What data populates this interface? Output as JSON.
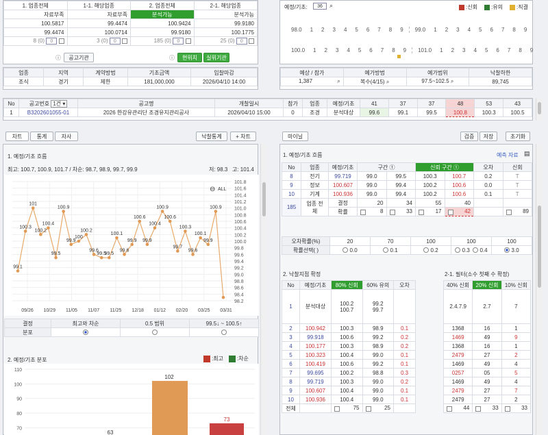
{
  "top_left": {
    "headers": [
      "1. 업종전체",
      "1-1. 해당업종",
      "2. 업종전체",
      "2-1. 해당업종"
    ],
    "rows": [
      [
        "자료부족",
        "자료부족",
        "분석가능",
        "분석가능"
      ],
      [
        "100.5817",
        "99.4474",
        "100.9424",
        "99.9180"
      ],
      [
        "99.4474",
        "100.0714",
        "99.9180",
        "100.1775"
      ]
    ],
    "counts": [
      "8 (0)",
      "3 (0)",
      "185 (0)",
      "25 (0)"
    ],
    "inputs": [
      "0",
      "0",
      "0",
      "0"
    ],
    "btn_notice": "공고기관",
    "btn_rank": "현위치",
    "btn_live": "실위기관"
  },
  "info_table": {
    "headers": [
      "업종",
      "지역",
      "계약방법",
      "기초금액",
      "입찰마감"
    ],
    "values": [
      "조식",
      "경기",
      "제한",
      "181,000,000",
      "2026/04/10 14:00"
    ]
  },
  "forecast": {
    "label": "예정/기초:",
    "value": "36",
    "legend": [
      {
        "label": ":신회",
        "color": "#c0392b"
      },
      {
        "label": ":유의",
        "color": "#2e7d32"
      },
      {
        "label": ":직결",
        "color": "#e0b030"
      }
    ],
    "row1_left": [
      "98.0",
      "1",
      "2",
      "3",
      "4",
      "5",
      "6",
      "7",
      "8",
      "9"
    ],
    "row1_right": [
      "99.0",
      "1",
      "2",
      "3",
      "4",
      "5",
      "6",
      "7",
      "8",
      "9"
    ],
    "row2_left": [
      "100.0",
      "1",
      "2",
      "3",
      "4",
      "5",
      "6",
      "7",
      "8",
      "9"
    ],
    "row2_right": [
      "101.0",
      "1",
      "2",
      "3",
      "4",
      "5",
      "6",
      "7",
      "8",
      "9"
    ]
  },
  "estimate": {
    "headers": [
      "예상 / 참가",
      "예가방법",
      "예가범위",
      "낙찰하한"
    ],
    "values": [
      "1,387",
      "복수(4/15)",
      "97.5~102.5",
      "89,745"
    ]
  },
  "bid_row": {
    "headers": [
      "No",
      "공고번호",
      "공고명",
      "개찰일시",
      "참가",
      "업종",
      "예정/기초",
      "41",
      "37",
      "37",
      "48",
      "53",
      "43"
    ],
    "count_select": "1건",
    "values": [
      "1",
      "B3202601055-01",
      "2026 한강유관리단 조경유지관리공사",
      "2026/04/10 15:00",
      "0",
      "조경",
      "분석대상",
      "99.6",
      "99.1",
      "99.5",
      "100.8",
      "100.3",
      "100.5"
    ]
  },
  "tabs_left": [
    "차트",
    "통계",
    "자사"
  ],
  "btn_stats": "낙찰통계",
  "btn_add_chart": "+ 차트",
  "tab_my": "마이닐",
  "btn_verify": "검증",
  "btn_save": "저장",
  "btn_reset": "초기화",
  "chart_section": {
    "title": "1. 예정/기초 흐름",
    "summary": "최고: 100.7, 100.9, 101.7 / 차순: 98.7, 98.9, 99.7, 99.9",
    "low": "저: 98.3",
    "high": "고: 101.4",
    "all_label": "ALL"
  },
  "chart_data": [
    {
      "type": "line",
      "title": "1. 예정/기초 흐름",
      "x": [
        "09/26",
        "10/29",
        "11/05",
        "11/07",
        "11/25",
        "12/18",
        "01/12",
        "02/20",
        "03/25",
        "03/31"
      ],
      "ylim": [
        98.2,
        101.8
      ],
      "yticks": [
        "101.8",
        "101.6",
        "101.4",
        "101.2",
        "101.0",
        "100.8",
        "100.6",
        "100.4",
        "100.2",
        "100.0",
        "99.8",
        "99.6",
        "99.4",
        "99.2",
        "99.0",
        "98.8",
        "98.6",
        "98.4",
        "98.2"
      ],
      "values": [
        99.1,
        100.3,
        101,
        100.2,
        100.4,
        99.5,
        100.9,
        99.9,
        100,
        100.2,
        99.6,
        99.5,
        99.5,
        100.1,
        99.6,
        99.9,
        100.6,
        99.9,
        100.4,
        100.9,
        100.6,
        99.7,
        100.3,
        99.6,
        100.1,
        99.9,
        100.9,
        98.3
      ],
      "labels": [
        "99.1",
        "100.3",
        "101",
        "100.2",
        "100.4",
        "99.5",
        "100.9",
        "99.9",
        "100",
        "100.2",
        "99.6",
        "99.5",
        "99.5",
        "100.1",
        "99.6",
        "99.9",
        "100.6",
        "99.9",
        "100.4",
        "100.9",
        "100.6",
        "99.7",
        "100.3",
        "99.6",
        "100.1",
        "99.9",
        "100.9",
        ""
      ]
    },
    {
      "type": "bar",
      "title": "2. 예정/기초 분포",
      "legend": [
        {
          "label": ":최고",
          "color": "#c0392b"
        },
        {
          "label": ":차순",
          "color": "#2e7d32"
        }
      ],
      "yticks": [
        "110",
        "100",
        "90",
        "80",
        "70"
      ],
      "ylim": [
        65,
        110
      ],
      "series": [
        {
          "name": "최고",
          "values": [
            63,
            102,
            73
          ]
        }
      ]
    }
  ],
  "chart_footer": {
    "headers": [
      "결정",
      "최고와 차순",
      "0.5 범위",
      "99.5↓ ~ 100.5↑"
    ],
    "row_label": "분포"
  },
  "flow_table": {
    "title": "1. 예정/기초 흐름",
    "link": "예측 자료",
    "headers": [
      "No",
      "업종",
      "예정/기초",
      "구간 ①",
      "신뢰 구간 ①",
      "오차",
      "신회"
    ],
    "rows": [
      [
        "8",
        "전기",
        "99.719",
        "99.0",
        "99.5",
        "100.3",
        "100.7",
        "0.2",
        "T"
      ],
      [
        "9",
        "정보",
        "100.607",
        "99.0",
        "99.4",
        "100.2",
        "100.6",
        "0.0",
        "T"
      ],
      [
        "10",
        "기계",
        "100.936",
        "99.0",
        "99.4",
        "100.2",
        "100.6",
        "0.1",
        "T"
      ]
    ],
    "total_no": "185",
    "total_label": "업종 전체",
    "decision": "결정",
    "decision_vals": [
      "20",
      "34",
      "55",
      "40"
    ],
    "prob": "확률",
    "prob_vals": [
      "8",
      "33",
      "17",
      "42",
      "89"
    ],
    "err_label": "오차확률(%)",
    "err_vals": [
      "20",
      "70",
      "100",
      "100",
      "100"
    ],
    "prob_select": "확률선택( )",
    "radio_vals": [
      "0.0",
      "0.1",
      "0.2",
      "0.3",
      "0.4",
      "3.0"
    ]
  },
  "win_table": {
    "title": "2. 낙찰지점 확정",
    "headers": [
      "No",
      "예정/기초",
      "80% 신회",
      "60% 유의",
      "오차"
    ],
    "first": {
      "no": "1",
      "label": "분석대상",
      "a": [
        "100.2",
        "100.7"
      ],
      "b": [
        "99.2",
        "99.7"
      ]
    },
    "rows": [
      [
        "2",
        "100.942",
        "100.3",
        "98.9",
        "0.1"
      ],
      [
        "3",
        "99.918",
        "100.6",
        "99.2",
        "0.2"
      ],
      [
        "4",
        "100.177",
        "100.3",
        "98.9",
        "0.2"
      ],
      [
        "5",
        "100.323",
        "100.4",
        "99.0",
        "0.1"
      ],
      [
        "6",
        "100.419",
        "100.6",
        "99.2",
        "0.1"
      ],
      [
        "7",
        "99.695",
        "100.2",
        "98.8",
        "0.3"
      ],
      [
        "8",
        "99.719",
        "100.3",
        "99.0",
        "0.2"
      ],
      [
        "9",
        "100.607",
        "100.4",
        "99.0",
        "0.1"
      ],
      [
        "10",
        "100.936",
        "100.4",
        "99.0",
        "0.1"
      ]
    ],
    "total": "전체",
    "total_vals": [
      "75",
      "25"
    ]
  },
  "filter_table": {
    "title": "2-1. 필터(소수 첫째 수 확정)",
    "headers": [
      "40% 신회",
      "20% 신회",
      "10% 신회"
    ],
    "first": [
      "2.4.7.9",
      "2.7",
      "7"
    ],
    "rows": [
      [
        "1368",
        "16",
        "1"
      ],
      [
        "1469",
        "49",
        "9"
      ],
      [
        "1368",
        "16",
        "1"
      ],
      [
        "2479",
        "27",
        "2"
      ],
      [
        "1469",
        "49",
        "4"
      ],
      [
        "0257",
        "05",
        "5"
      ],
      [
        "1469",
        "49",
        "4"
      ],
      [
        "2479",
        "27",
        "7"
      ],
      [
        "2479",
        "27",
        "2"
      ]
    ],
    "total_vals": [
      "44",
      "33",
      "33"
    ]
  }
}
